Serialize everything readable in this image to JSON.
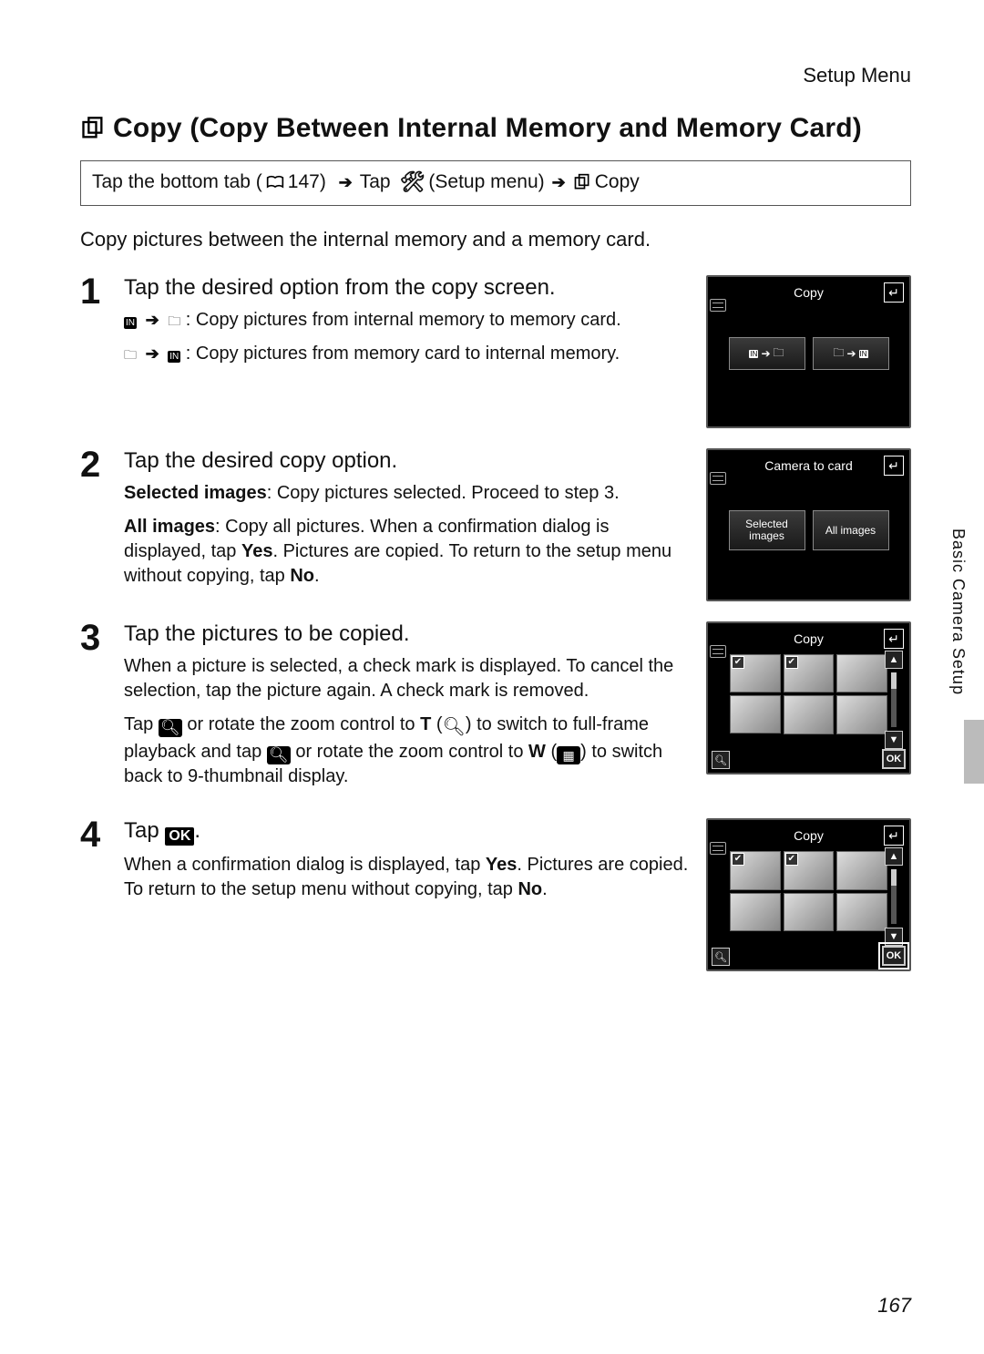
{
  "header": {
    "section": "Setup Menu"
  },
  "title_icon": "copy-icon",
  "title": "Copy (Copy Between Internal Memory and Memory Card)",
  "breadcrumb": {
    "t1": "Tap the bottom tab (",
    "pageRef": "147) ",
    "t2": "Tap ",
    "t3": " (Setup menu) ",
    "t4": " Copy"
  },
  "intro": "Copy pictures between the internal memory and a memory card.",
  "steps": {
    "s1": {
      "num": "1",
      "head": "Tap the desired option from the copy screen.",
      "l1b": ": Copy pictures from internal memory to memory card.",
      "l2b": ": Copy pictures from memory card to internal memory."
    },
    "s2": {
      "num": "2",
      "head": "Tap the desired copy option.",
      "p1a": "Selected images",
      "p1b": ": Copy pictures selected. Proceed to step 3.",
      "p2a": "All images",
      "p2b": ": Copy all pictures. When a confirmation dialog is displayed, tap ",
      "p2c": "Yes",
      "p2d": ". Pictures are copied. To return to the setup menu without copying, tap ",
      "p2e": "No",
      "p2f": "."
    },
    "s3": {
      "num": "3",
      "head": "Tap the pictures to be copied.",
      "p1": "When a picture is selected, a check mark is displayed. To cancel the selection, tap the picture again. A check mark is removed.",
      "p2a": "Tap ",
      "p2b": " or rotate the zoom control to ",
      "p2c": "T",
      "p2d": " (",
      "p2e": ") to switch to full-frame playback and tap ",
      "p2f": " or rotate the zoom control to ",
      "p2g": "W",
      "p2h": " (",
      "p2i": ") to switch back to 9-thumbnail display."
    },
    "s4": {
      "num": "4",
      "head_a": "Tap ",
      "head_b": ".",
      "p1a": "When a confirmation dialog is displayed, tap ",
      "p1b": "Yes",
      "p1c": ". Pictures are copied. To return to the setup menu without copying, tap ",
      "p1d": "No",
      "p1e": "."
    }
  },
  "lcd1": {
    "title": "Copy",
    "btn1": "IN → 🗀",
    "btn2": "🗀 → IN"
  },
  "lcd2": {
    "title": "Camera to card",
    "btn1": "Selected images",
    "btn2": "All images"
  },
  "lcd3": {
    "title": "Copy",
    "ok": "OK"
  },
  "lcd4": {
    "title": "Copy",
    "ok": "OK"
  },
  "sideTab": "Basic Camera Setup",
  "pageNumber": "167"
}
